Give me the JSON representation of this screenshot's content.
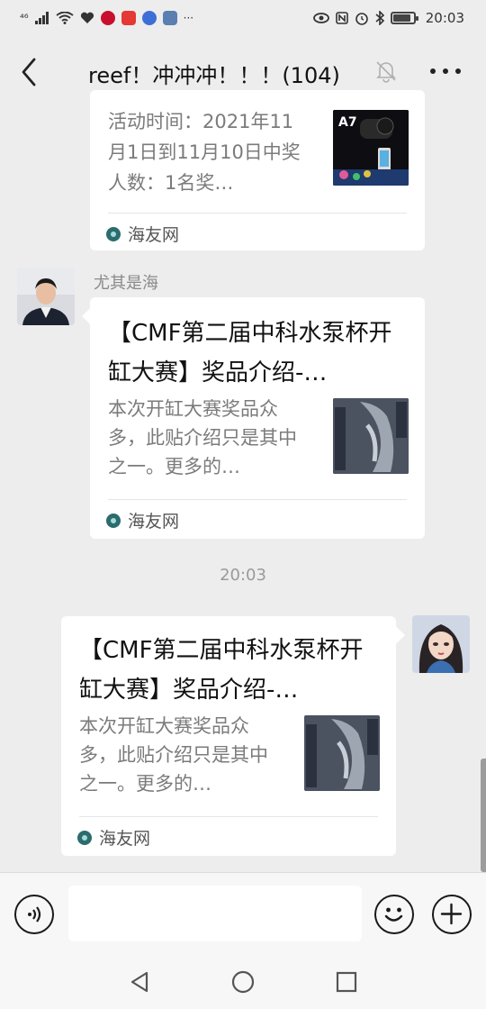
{
  "status_bar": {
    "network": "⁴⁶",
    "time": "20:03",
    "battery_level": 0.8,
    "icons": [
      "signal-icon",
      "wifi-icon",
      "health-icon",
      "app-icon",
      "app-icon",
      "music-icon",
      "app-icon",
      "more-notifications-icon",
      "eye-comfort-icon",
      "nfc-icon",
      "alarm-icon",
      "bluetooth-icon",
      "battery-icon"
    ]
  },
  "nav": {
    "title": "reef！冲冲冲！！！(104)",
    "muted": true
  },
  "messages": [
    {
      "type": "link-card",
      "direction": "incoming",
      "desc": "活动时间：2021年11月1日到11月10日中奖人数：1名奖…",
      "source": "海友网",
      "thumb_label": "A7"
    },
    {
      "type": "link-card",
      "direction": "incoming",
      "sender": "尤其是海",
      "title": "【CMF第二届中科水泵杯开缸大赛】奖品介绍-…",
      "desc": "本次开缸大赛奖品众多，此贴介绍只是其中之一。更多的…",
      "source": "海友网"
    },
    {
      "type": "timestamp",
      "text": "20:03"
    },
    {
      "type": "link-card",
      "direction": "outgoing",
      "title": "【CMF第二届中科水泵杯开缸大赛】奖品介绍-…",
      "desc": "本次开缸大赛奖品众多，此贴介绍只是其中之一。更多的…",
      "source": "海友网"
    }
  ],
  "colors": {
    "background": "#ededed",
    "card": "#ffffff",
    "source_logo": "#2c6b6e"
  }
}
